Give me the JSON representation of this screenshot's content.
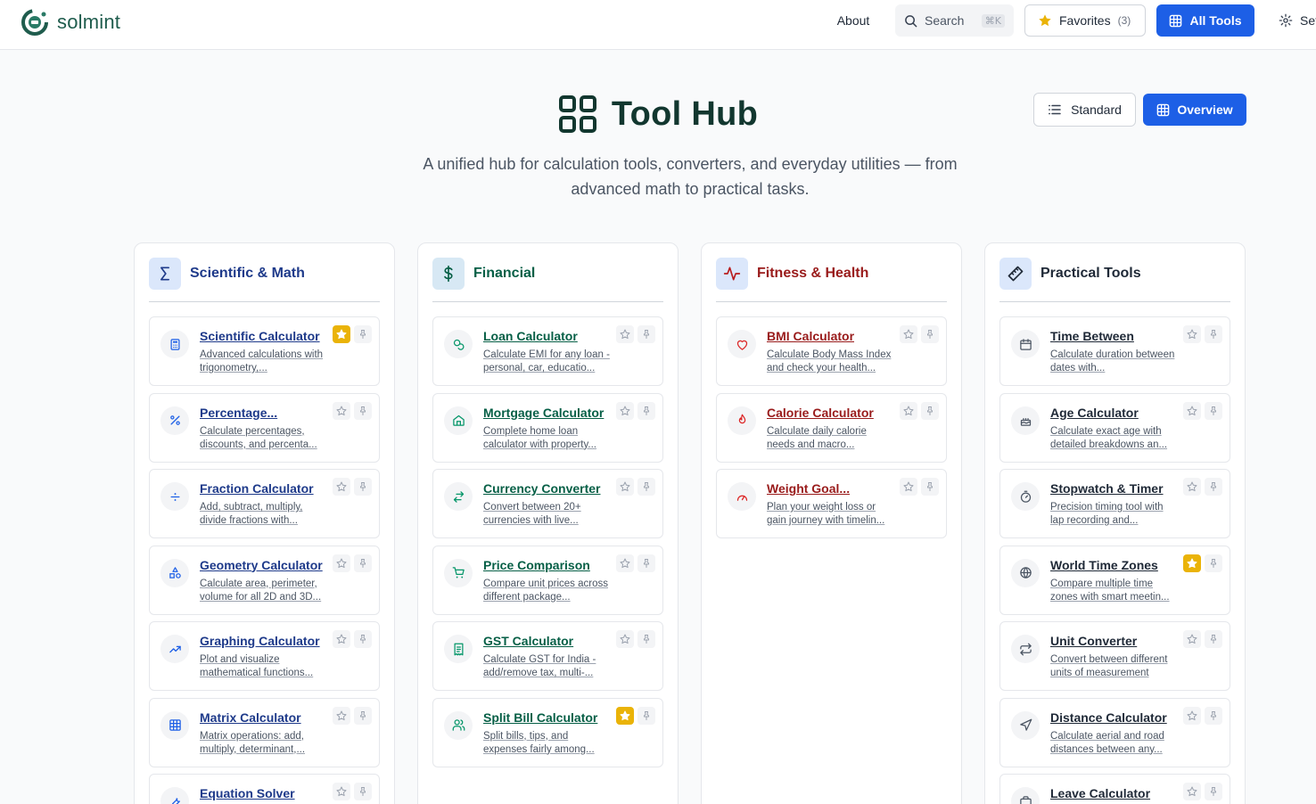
{
  "header": {
    "brand": "solmint",
    "about": "About",
    "search_label": "Search",
    "search_shortcut": "⌘K",
    "favorites_label": "Favorites",
    "favorites_count": "(3)",
    "all_tools_label": "All Tools",
    "settings_label": "Settings"
  },
  "hero": {
    "title": "Tool Hub",
    "subtitle": "A unified hub for calculation tools, converters, and everyday utilities — from advanced math to practical tasks.",
    "view_standard": "Standard",
    "view_overview": "Overview"
  },
  "colors": {
    "primary": "#1d5fe6",
    "scientific": "#1e3a8a",
    "financial": "#065f46",
    "fitness": "#991b1b",
    "practical": "#1f2937",
    "favorite": "#eab308"
  },
  "columns": [
    {
      "title": "Scientific & Math",
      "icon": "sigma-icon",
      "tools": [
        {
          "title": "Scientific Calculator",
          "desc": "Advanced calculations with trigonometry,...",
          "icon": "calculator-icon",
          "favorite": true
        },
        {
          "title": "Percentage...",
          "desc": "Calculate percentages, discounts, and percenta...",
          "icon": "percent-icon",
          "favorite": false
        },
        {
          "title": "Fraction Calculator",
          "desc": "Add, subtract, multiply, divide fractions with...",
          "icon": "divide-icon",
          "favorite": false
        },
        {
          "title": "Geometry Calculator",
          "desc": "Calculate area, perimeter, volume for all 2D and 3D...",
          "icon": "shapes-icon",
          "favorite": false
        },
        {
          "title": "Graphing Calculator",
          "desc": "Plot and visualize mathematical functions...",
          "icon": "trend-icon",
          "favorite": false
        },
        {
          "title": "Matrix Calculator",
          "desc": "Matrix operations: add, multiply, determinant,...",
          "icon": "grid-icon",
          "favorite": false
        },
        {
          "title": "Equation Solver",
          "desc": "",
          "icon": "wrench-icon",
          "favorite": false
        }
      ]
    },
    {
      "title": "Financial",
      "icon": "dollar-icon",
      "tools": [
        {
          "title": "Loan Calculator",
          "desc": "Calculate EMI for any loan - personal, car, educatio...",
          "icon": "coins-icon",
          "favorite": false
        },
        {
          "title": "Mortgage Calculator",
          "desc": "Complete home loan calculator with property...",
          "icon": "home-icon",
          "favorite": false
        },
        {
          "title": "Currency Converter",
          "desc": "Convert between 20+ currencies with live...",
          "icon": "exchange-icon",
          "favorite": false
        },
        {
          "title": "Price Comparison",
          "desc": "Compare unit prices across different package...",
          "icon": "cart-icon",
          "favorite": false
        },
        {
          "title": "GST Calculator",
          "desc": "Calculate GST for India - add/remove tax, multi-...",
          "icon": "receipt-icon",
          "favorite": false
        },
        {
          "title": "Split Bill Calculator",
          "desc": "Split bills, tips, and expenses fairly among...",
          "icon": "users-icon",
          "favorite": true
        }
      ]
    },
    {
      "title": "Fitness & Health",
      "icon": "pulse-icon",
      "tools": [
        {
          "title": "BMI Calculator",
          "desc": "Calculate Body Mass Index and check your health...",
          "icon": "heart-icon",
          "favorite": false
        },
        {
          "title": "Calorie Calculator",
          "desc": "Calculate daily calorie needs and macro...",
          "icon": "flame-icon",
          "favorite": false
        },
        {
          "title": "Weight Goal...",
          "desc": "Plan your weight loss or gain journey with timelin...",
          "icon": "gauge-icon",
          "favorite": false
        }
      ]
    },
    {
      "title": "Practical Tools",
      "icon": "ruler-icon",
      "tools": [
        {
          "title": "Time Between",
          "desc": "Calculate duration between dates with...",
          "icon": "calendar-icon",
          "favorite": false
        },
        {
          "title": "Age Calculator",
          "desc": "Calculate exact age with detailed breakdowns an...",
          "icon": "cake-icon",
          "favorite": false
        },
        {
          "title": "Stopwatch & Timer",
          "desc": "Precision timing tool with lap recording and...",
          "icon": "stopwatch-icon",
          "favorite": false
        },
        {
          "title": "World Time Zones",
          "desc": "Compare multiple time zones with smart meetin...",
          "icon": "globe-icon",
          "favorite": true
        },
        {
          "title": "Unit Converter",
          "desc": "Convert between different units of measurement",
          "icon": "swap-icon",
          "favorite": false
        },
        {
          "title": "Distance Calculator",
          "desc": "Calculate aerial and road distances between any...",
          "icon": "navigation-icon",
          "favorite": false
        },
        {
          "title": "Leave Calculator",
          "desc": "",
          "icon": "briefcase-icon",
          "favorite": false
        }
      ]
    }
  ]
}
